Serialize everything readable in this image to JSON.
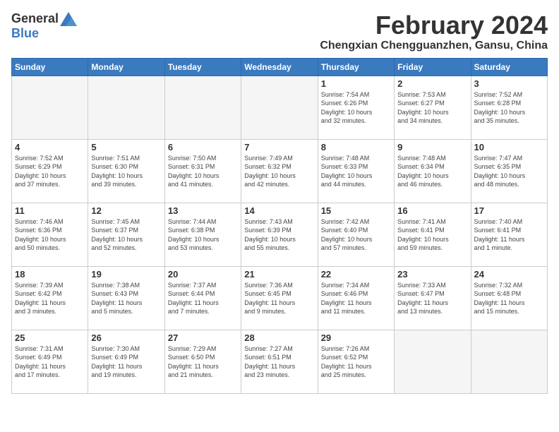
{
  "header": {
    "logo_general": "General",
    "logo_blue": "Blue",
    "month_title": "February 2024",
    "location": "Chengxian Chengguanzhen, Gansu, China"
  },
  "weekdays": [
    "Sunday",
    "Monday",
    "Tuesday",
    "Wednesday",
    "Thursday",
    "Friday",
    "Saturday"
  ],
  "weeks": [
    [
      {
        "day": "",
        "info": ""
      },
      {
        "day": "",
        "info": ""
      },
      {
        "day": "",
        "info": ""
      },
      {
        "day": "",
        "info": ""
      },
      {
        "day": "1",
        "info": "Sunrise: 7:54 AM\nSunset: 6:26 PM\nDaylight: 10 hours\nand 32 minutes."
      },
      {
        "day": "2",
        "info": "Sunrise: 7:53 AM\nSunset: 6:27 PM\nDaylight: 10 hours\nand 34 minutes."
      },
      {
        "day": "3",
        "info": "Sunrise: 7:52 AM\nSunset: 6:28 PM\nDaylight: 10 hours\nand 35 minutes."
      }
    ],
    [
      {
        "day": "4",
        "info": "Sunrise: 7:52 AM\nSunset: 6:29 PM\nDaylight: 10 hours\nand 37 minutes."
      },
      {
        "day": "5",
        "info": "Sunrise: 7:51 AM\nSunset: 6:30 PM\nDaylight: 10 hours\nand 39 minutes."
      },
      {
        "day": "6",
        "info": "Sunrise: 7:50 AM\nSunset: 6:31 PM\nDaylight: 10 hours\nand 41 minutes."
      },
      {
        "day": "7",
        "info": "Sunrise: 7:49 AM\nSunset: 6:32 PM\nDaylight: 10 hours\nand 42 minutes."
      },
      {
        "day": "8",
        "info": "Sunrise: 7:48 AM\nSunset: 6:33 PM\nDaylight: 10 hours\nand 44 minutes."
      },
      {
        "day": "9",
        "info": "Sunrise: 7:48 AM\nSunset: 6:34 PM\nDaylight: 10 hours\nand 46 minutes."
      },
      {
        "day": "10",
        "info": "Sunrise: 7:47 AM\nSunset: 6:35 PM\nDaylight: 10 hours\nand 48 minutes."
      }
    ],
    [
      {
        "day": "11",
        "info": "Sunrise: 7:46 AM\nSunset: 6:36 PM\nDaylight: 10 hours\nand 50 minutes."
      },
      {
        "day": "12",
        "info": "Sunrise: 7:45 AM\nSunset: 6:37 PM\nDaylight: 10 hours\nand 52 minutes."
      },
      {
        "day": "13",
        "info": "Sunrise: 7:44 AM\nSunset: 6:38 PM\nDaylight: 10 hours\nand 53 minutes."
      },
      {
        "day": "14",
        "info": "Sunrise: 7:43 AM\nSunset: 6:39 PM\nDaylight: 10 hours\nand 55 minutes."
      },
      {
        "day": "15",
        "info": "Sunrise: 7:42 AM\nSunset: 6:40 PM\nDaylight: 10 hours\nand 57 minutes."
      },
      {
        "day": "16",
        "info": "Sunrise: 7:41 AM\nSunset: 6:41 PM\nDaylight: 10 hours\nand 59 minutes."
      },
      {
        "day": "17",
        "info": "Sunrise: 7:40 AM\nSunset: 6:41 PM\nDaylight: 11 hours\nand 1 minute."
      }
    ],
    [
      {
        "day": "18",
        "info": "Sunrise: 7:39 AM\nSunset: 6:42 PM\nDaylight: 11 hours\nand 3 minutes."
      },
      {
        "day": "19",
        "info": "Sunrise: 7:38 AM\nSunset: 6:43 PM\nDaylight: 11 hours\nand 5 minutes."
      },
      {
        "day": "20",
        "info": "Sunrise: 7:37 AM\nSunset: 6:44 PM\nDaylight: 11 hours\nand 7 minutes."
      },
      {
        "day": "21",
        "info": "Sunrise: 7:36 AM\nSunset: 6:45 PM\nDaylight: 11 hours\nand 9 minutes."
      },
      {
        "day": "22",
        "info": "Sunrise: 7:34 AM\nSunset: 6:46 PM\nDaylight: 11 hours\nand 11 minutes."
      },
      {
        "day": "23",
        "info": "Sunrise: 7:33 AM\nSunset: 6:47 PM\nDaylight: 11 hours\nand 13 minutes."
      },
      {
        "day": "24",
        "info": "Sunrise: 7:32 AM\nSunset: 6:48 PM\nDaylight: 11 hours\nand 15 minutes."
      }
    ],
    [
      {
        "day": "25",
        "info": "Sunrise: 7:31 AM\nSunset: 6:49 PM\nDaylight: 11 hours\nand 17 minutes."
      },
      {
        "day": "26",
        "info": "Sunrise: 7:30 AM\nSunset: 6:49 PM\nDaylight: 11 hours\nand 19 minutes."
      },
      {
        "day": "27",
        "info": "Sunrise: 7:29 AM\nSunset: 6:50 PM\nDaylight: 11 hours\nand 21 minutes."
      },
      {
        "day": "28",
        "info": "Sunrise: 7:27 AM\nSunset: 6:51 PM\nDaylight: 11 hours\nand 23 minutes."
      },
      {
        "day": "29",
        "info": "Sunrise: 7:26 AM\nSunset: 6:52 PM\nDaylight: 11 hours\nand 25 minutes."
      },
      {
        "day": "",
        "info": ""
      },
      {
        "day": "",
        "info": ""
      }
    ]
  ]
}
